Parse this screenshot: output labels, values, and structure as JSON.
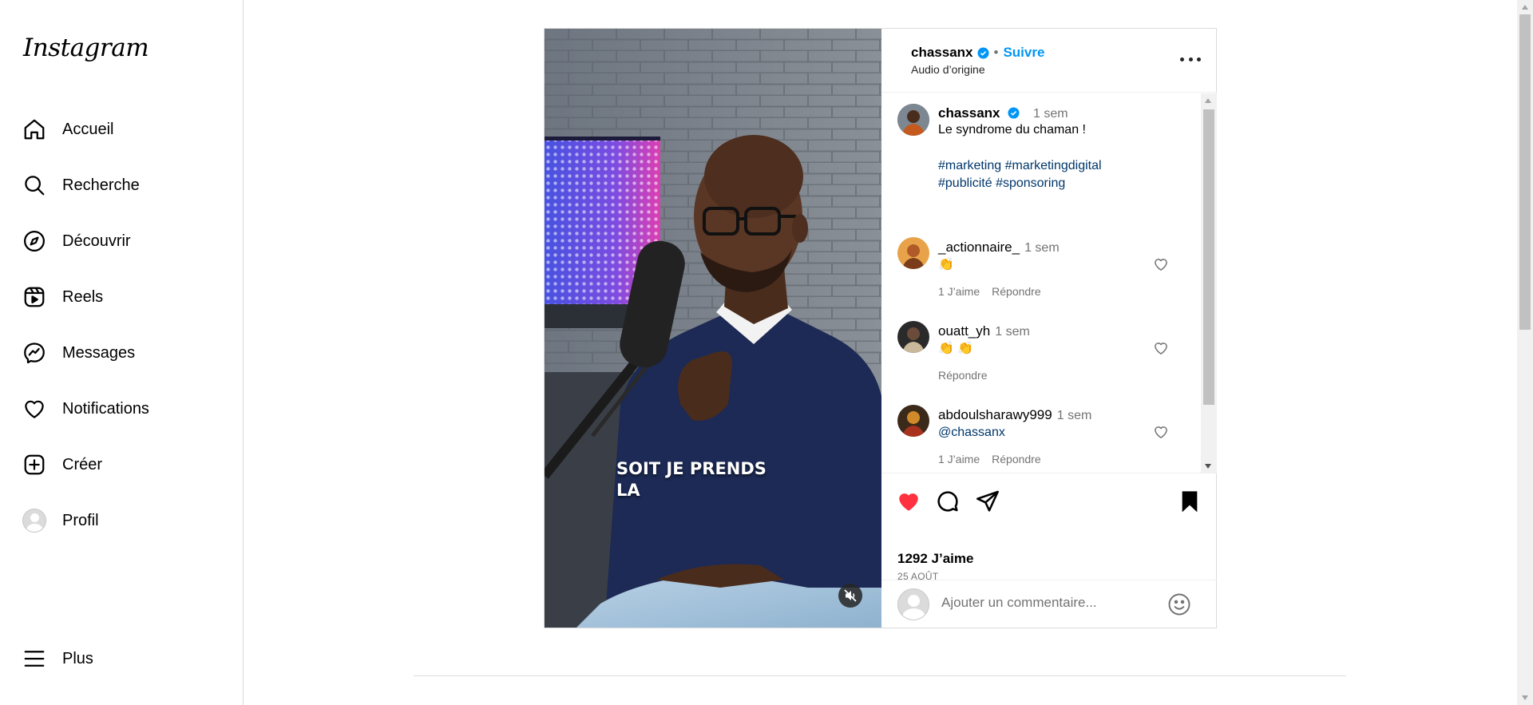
{
  "app": {
    "logo": "Instagram"
  },
  "sidebar": {
    "items": [
      {
        "label": "Accueil",
        "icon": "home-icon"
      },
      {
        "label": "Recherche",
        "icon": "search-icon"
      },
      {
        "label": "Découvrir",
        "icon": "compass-icon"
      },
      {
        "label": "Reels",
        "icon": "reels-icon"
      },
      {
        "label": "Messages",
        "icon": "messenger-icon"
      },
      {
        "label": "Notifications",
        "icon": "heart-icon"
      },
      {
        "label": "Créer",
        "icon": "plus-square-icon"
      },
      {
        "label": "Profil",
        "icon": "avatar"
      }
    ],
    "more": {
      "label": "Plus",
      "icon": "hamburger-icon"
    }
  },
  "post": {
    "header": {
      "username": "chassanx",
      "separator": "•",
      "follow_label": "Suivre",
      "audio": "Audio d’origine"
    },
    "media": {
      "caption_overlay": "SOIT JE PRENDS\nLA"
    },
    "caption": {
      "username": "chassanx",
      "time": "1 sem",
      "text": "Le syndrome du chaman !",
      "hashtags_line1": [
        "#marketing",
        "#marketingdigital"
      ],
      "hashtags_line2": [
        "#publicité",
        "#sponsoring"
      ]
    },
    "comments": [
      {
        "username": "_actionnaire_",
        "time": "1 sem",
        "text": "👏",
        "likes": "1 J’aime",
        "reply": "Répondre"
      },
      {
        "username": "ouatt_yh",
        "time": "1 sem",
        "text": "👏 👏",
        "likes": "",
        "reply": "Répondre"
      },
      {
        "username": "abdoulsharawy999",
        "time": "1 sem",
        "text": "@chassanx",
        "likes": "1 J’aime",
        "reply": "Répondre"
      }
    ],
    "likes_label": "1292 J’aime",
    "date": "25 AOÛT",
    "add_comment": {
      "placeholder": "Ajouter un commentaire..."
    },
    "liked": true,
    "saved": true
  },
  "colors": {
    "accent": "#0095f6",
    "like_red": "#ff3040",
    "hashtag": "#00376b",
    "muted": "#737373"
  }
}
